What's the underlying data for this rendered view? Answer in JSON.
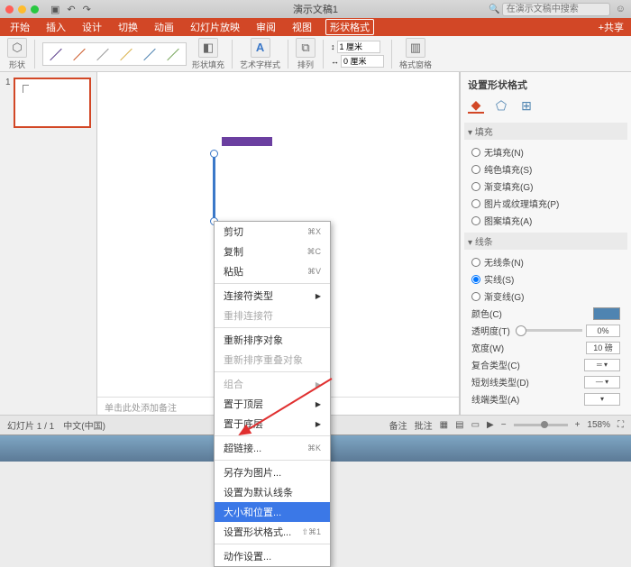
{
  "titlebar": {
    "title": "演示文稿1",
    "search_placeholder": "在演示文稿中搜索"
  },
  "tabs": {
    "items": [
      "开始",
      "插入",
      "设计",
      "切换",
      "动画",
      "幻灯片放映",
      "审阅",
      "视图",
      "形状格式"
    ],
    "active": "形状格式",
    "share": "+共享"
  },
  "ribbon": {
    "shape": "形状",
    "fill": "形状填充",
    "wordart": "艺术字样式",
    "arrange": "排列",
    "height": "1 厘米",
    "width": "0 厘米",
    "fmtpane": "格式窗格"
  },
  "thumb": {
    "num": "1"
  },
  "notes_placeholder": "单击此处添加备注",
  "fmtpane": {
    "title": "设置形状格式",
    "fill_h": "填充",
    "fill_opts": [
      "无填充(N)",
      "纯色填充(S)",
      "渐变填充(G)",
      "图片或纹理填充(P)",
      "图案填充(A)"
    ],
    "line_h": "线条",
    "line_opts": [
      "无线条(N)",
      "实线(S)",
      "渐变线(G)"
    ],
    "line_sel": 1,
    "color_l": "颜色(C)",
    "trans_l": "透明度(T)",
    "trans_v": "0%",
    "width_l": "宽度(W)",
    "width_v": "10 磅",
    "compound_l": "复合类型(C)",
    "dash_l": "短划线类型(D)",
    "cap_l": "线端类型(A)"
  },
  "ctx": {
    "cut": "剪切",
    "cut_k": "⌘X",
    "copy": "复制",
    "copy_k": "⌘C",
    "paste": "粘贴",
    "paste_k": "⌘V",
    "connector": "连接符类型",
    "reroute": "重排连接符",
    "reorder": "重新排序对象",
    "reorder_ol": "重新排序重叠对象",
    "group": "组合",
    "front": "置于顶层",
    "back": "置于底层",
    "hyperlink": "超链接...",
    "hyperlink_k": "⌘K",
    "saveimg": "另存为图片...",
    "defaultline": "设置为默认线条",
    "sizepos": "大小和位置...",
    "fmtshape": "设置形状格式...",
    "fmtshape_k": "⇧⌘1",
    "action": "动作设置..."
  },
  "status": {
    "slide": "幻灯片 1 / 1",
    "lang": "中文(中国)",
    "notes": "备注",
    "comments": "批注",
    "zoom": "158%"
  }
}
